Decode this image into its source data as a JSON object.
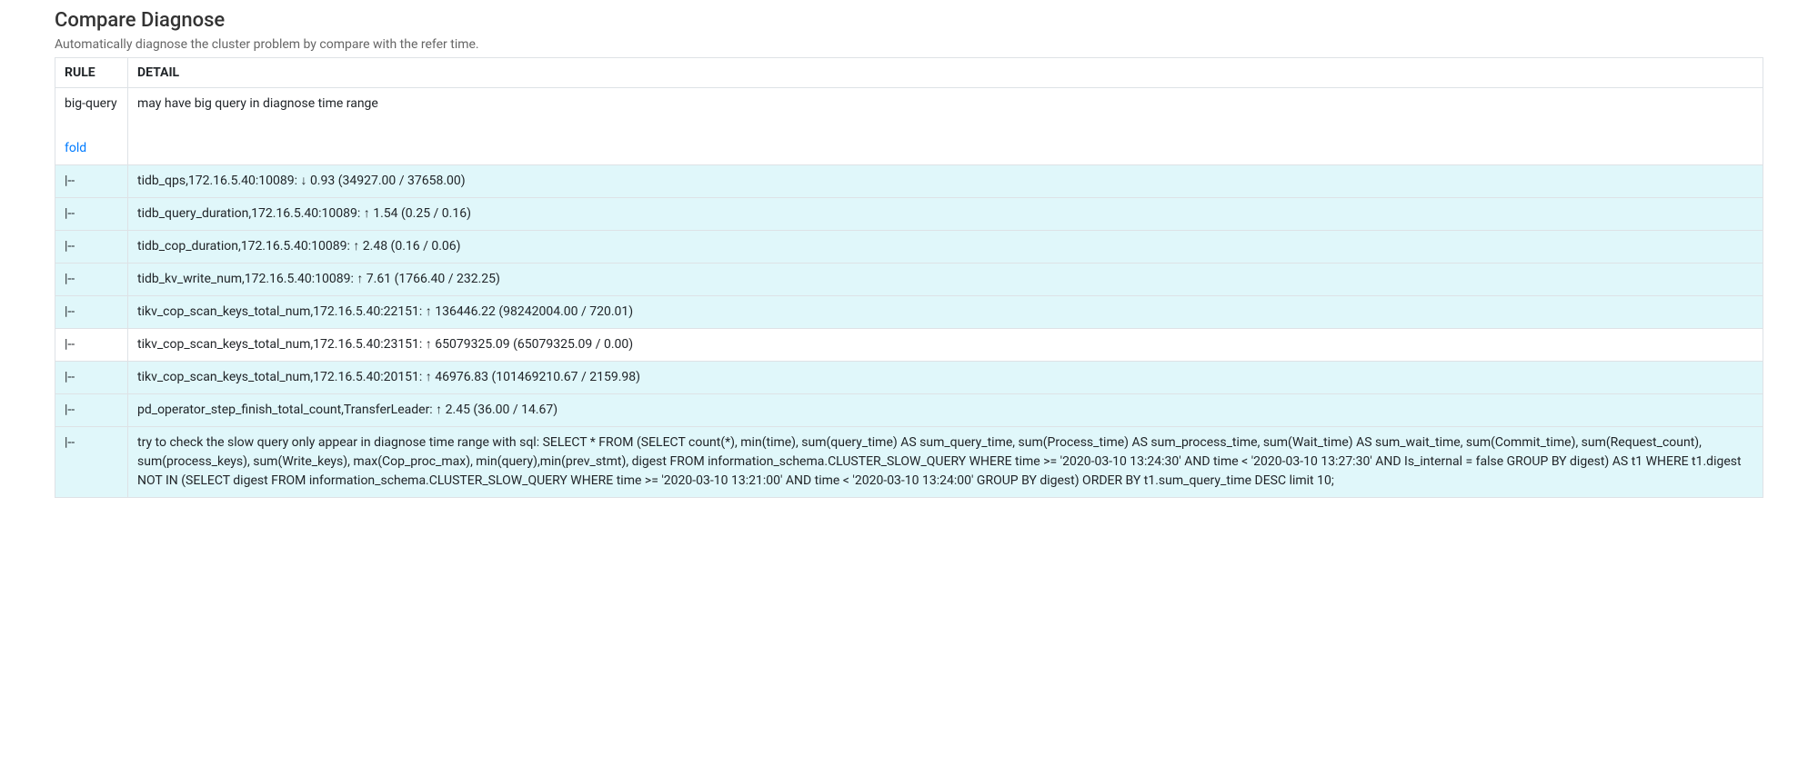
{
  "header": {
    "title": "Compare Diagnose",
    "subtitle": "Automatically diagnose the cluster problem by compare with the refer time."
  },
  "table": {
    "columns": {
      "rule": "RULE",
      "detail": "DETAIL"
    },
    "firstRow": {
      "rule": "big-query",
      "fold": "fold",
      "detail": "may have big query in diagnose time range"
    },
    "rows": [
      {
        "rule": "|--",
        "detail": "tidb_qps,172.16.5.40:10089: ↓ 0.93 (34927.00 / 37658.00)",
        "highlight": true
      },
      {
        "rule": "|--",
        "detail": "tidb_query_duration,172.16.5.40:10089: ↑ 1.54 (0.25 / 0.16)",
        "highlight": true
      },
      {
        "rule": "|--",
        "detail": "tidb_cop_duration,172.16.5.40:10089: ↑ 2.48 (0.16 / 0.06)",
        "highlight": true
      },
      {
        "rule": "|--",
        "detail": "tidb_kv_write_num,172.16.5.40:10089: ↑ 7.61 (1766.40 / 232.25)",
        "highlight": true
      },
      {
        "rule": "|--",
        "detail": "tikv_cop_scan_keys_total_num,172.16.5.40:22151: ↑ 136446.22 (98242004.00 / 720.01)",
        "highlight": true
      },
      {
        "rule": "|--",
        "detail": "tikv_cop_scan_keys_total_num,172.16.5.40:23151: ↑ 65079325.09 (65079325.09 / 0.00)",
        "highlight": false
      },
      {
        "rule": "|--",
        "detail": "tikv_cop_scan_keys_total_num,172.16.5.40:20151: ↑ 46976.83 (101469210.67 / 2159.98)",
        "highlight": true
      },
      {
        "rule": "|--",
        "detail": "pd_operator_step_finish_total_count,TransferLeader: ↑ 2.45 (36.00 / 14.67)",
        "highlight": true
      },
      {
        "rule": "|--",
        "detail": "try to check the slow query only appear in diagnose time range with sql: SELECT * FROM (SELECT count(*), min(time), sum(query_time) AS sum_query_time, sum(Process_time) AS sum_process_time, sum(Wait_time) AS sum_wait_time, sum(Commit_time), sum(Request_count), sum(process_keys), sum(Write_keys), max(Cop_proc_max), min(query),min(prev_stmt), digest FROM information_schema.CLUSTER_SLOW_QUERY WHERE time >= '2020-03-10 13:24:30' AND time < '2020-03-10 13:27:30' AND Is_internal = false GROUP BY digest) AS t1 WHERE t1.digest NOT IN (SELECT digest FROM information_schema.CLUSTER_SLOW_QUERY WHERE time >= '2020-03-10 13:21:00' AND time < '2020-03-10 13:24:00' GROUP BY digest) ORDER BY t1.sum_query_time DESC limit 10;",
        "highlight": true
      }
    ]
  }
}
